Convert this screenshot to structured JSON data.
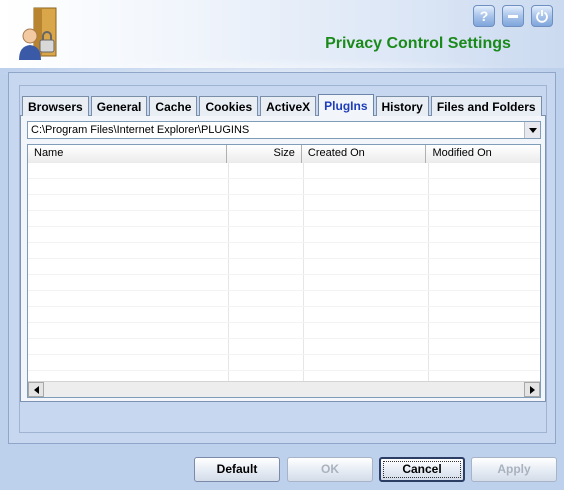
{
  "window": {
    "title": "Privacy Control Settings",
    "controls": [
      {
        "name": "help",
        "icon": "question-icon"
      },
      {
        "name": "minimize",
        "icon": "minimize-icon"
      },
      {
        "name": "power",
        "icon": "power-icon"
      }
    ]
  },
  "tabs": [
    {
      "label": "Browsers",
      "active": false
    },
    {
      "label": "General",
      "active": false
    },
    {
      "label": "Cache",
      "active": false
    },
    {
      "label": "Cookies",
      "active": false
    },
    {
      "label": "ActiveX",
      "active": false
    },
    {
      "label": "PlugIns",
      "active": true
    },
    {
      "label": "History",
      "active": false
    },
    {
      "label": "Files and Folders",
      "active": false
    }
  ],
  "plugins": {
    "folder_path": "C:\\Program Files\\Internet Explorer\\PLUGINS",
    "columns": [
      "Name",
      "Size",
      "Created On",
      "Modified On"
    ],
    "rows": []
  },
  "buttons": {
    "default": "Default",
    "ok": "OK",
    "cancel": "Cancel",
    "apply": "Apply"
  },
  "colors": {
    "title_green": "#1a8a1a",
    "active_tab_text": "#1f3db8",
    "background": "#bdd0ec"
  }
}
